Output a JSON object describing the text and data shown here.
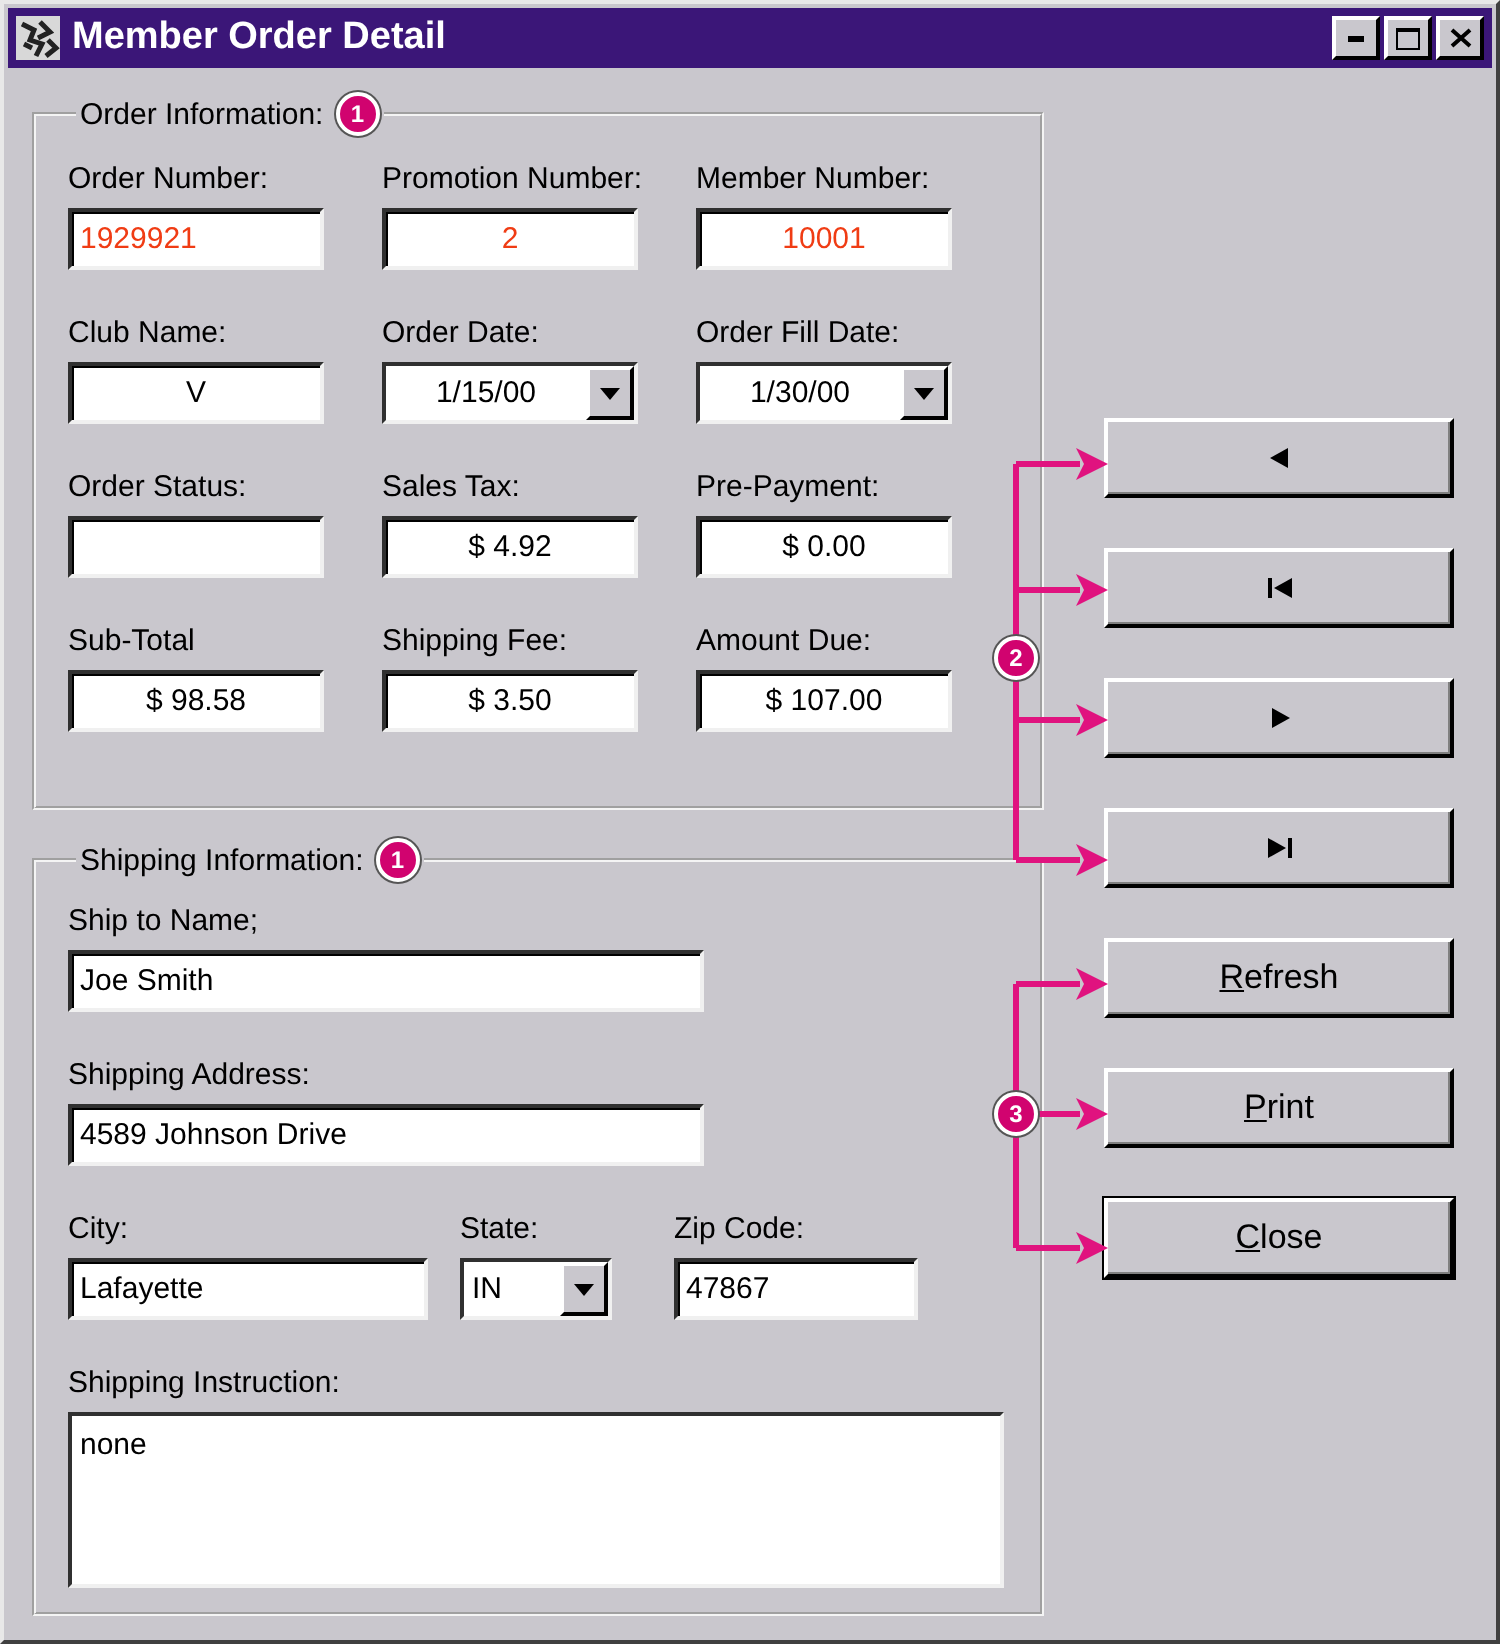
{
  "window": {
    "title": "Member Order Detail"
  },
  "order_information": {
    "title": "Order Information:",
    "callout": "1",
    "fields": [
      {
        "label": "Order Number:",
        "value": "1929921",
        "kind": "text",
        "left_aligned": true,
        "color": "#f03c14"
      },
      {
        "label": "Promotion Number:",
        "value": "2",
        "kind": "text",
        "left_aligned": false,
        "color": "#f03c14"
      },
      {
        "label": "Member Number:",
        "value": "10001",
        "kind": "text",
        "left_aligned": false,
        "color": "#f03c14"
      },
      {
        "label": "Club Name:",
        "value": "V",
        "kind": "text",
        "left_aligned": false,
        "color": "#000000"
      },
      {
        "label": "Order Date:",
        "value": "1/15/00",
        "kind": "dropdown",
        "left_aligned": false,
        "color": "#000000"
      },
      {
        "label": "Order Fill Date:",
        "value": "1/30/00",
        "kind": "dropdown",
        "left_aligned": false,
        "color": "#000000"
      },
      {
        "label": "Order Status:",
        "kind": "text",
        "color": "#000000"
      },
      {
        "label": "Sales Tax:",
        "value": "$ 4.92",
        "kind": "text",
        "left_aligned": false,
        "color": "#000000"
      },
      {
        "label": "Pre-Payment:",
        "value": "$ 0.00",
        "kind": "text",
        "left_aligned": false,
        "color": "#000000"
      },
      {
        "label": "Sub-Total",
        "value": "$ 98.58",
        "kind": "text",
        "left_aligned": false,
        "color": "#000000"
      },
      {
        "label": "Shipping Fee:",
        "value": "$ 3.50",
        "kind": "text",
        "left_aligned": false,
        "color": "#000000"
      },
      {
        "label": "Amount Due:",
        "value": "$ 107.00",
        "kind": "text",
        "left_aligned": false,
        "color": "#000000"
      }
    ]
  },
  "shipping_information": {
    "title": "Shipping Information:",
    "callout": "1",
    "rows": [
      [
        {
          "label": "Ship to Name;",
          "value": "Joe Smith",
          "kind": "text"
        }
      ],
      [
        {
          "label": "Shipping Address:",
          "value": "4589 Johnson Drive",
          "kind": "text"
        }
      ],
      [
        {
          "label": "City:",
          "value": "Lafayette",
          "kind": "text"
        },
        {
          "label": "State:",
          "value": "IN",
          "kind": "dropdown"
        },
        {
          "label": "Zip Code:",
          "value": "47867",
          "kind": "text"
        }
      ],
      [
        {
          "label": "Shipping Instruction:",
          "value": "none",
          "kind": "memo"
        }
      ]
    ]
  },
  "navigation": {
    "callout": "2",
    "buttons": [
      {
        "kind": "previous"
      },
      {
        "kind": "first"
      },
      {
        "kind": "next"
      },
      {
        "kind": "last"
      }
    ]
  },
  "actions": {
    "callout": "3",
    "buttons": [
      {
        "label": "Refresh",
        "underline_first": true,
        "default": false
      },
      {
        "label": "Print",
        "underline_first": true,
        "default": false
      },
      {
        "label": "Close",
        "underline_first": true,
        "default": true
      }
    ]
  }
}
